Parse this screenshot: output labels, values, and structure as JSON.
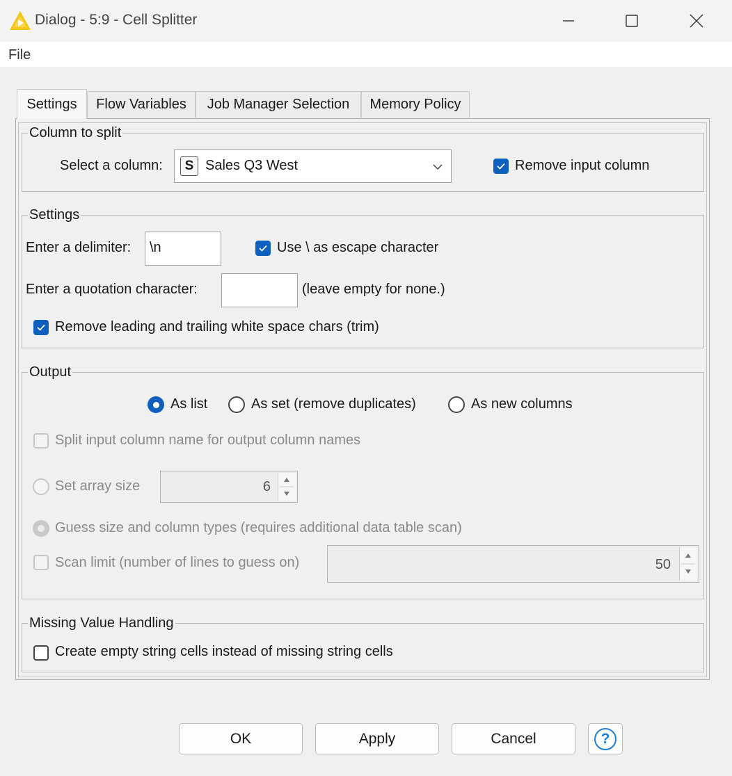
{
  "window": {
    "title": "Dialog - 5:9 - Cell Splitter"
  },
  "menu": {
    "file": "File"
  },
  "tabs": [
    "Settings",
    "Flow Variables",
    "Job Manager Selection",
    "Memory Policy"
  ],
  "column_group": {
    "legend": "Column to split",
    "select_label": "Select a column:",
    "type_badge": "S",
    "selected_column": "Sales Q3 West",
    "remove_input_label": "Remove input column",
    "remove_input_checked": true
  },
  "settings_group": {
    "legend": "Settings",
    "delimiter_label": "Enter a delimiter:",
    "delimiter_value": "\\n",
    "escape_label": "Use \\ as escape character",
    "escape_checked": true,
    "quote_label": "Enter a quotation character:",
    "quote_value": "",
    "quote_hint": "(leave empty for none.)",
    "trim_label": "Remove leading and trailing white space chars (trim)",
    "trim_checked": true
  },
  "output_group": {
    "legend": "Output",
    "options": [
      "As list",
      "As set (remove duplicates)",
      "As new columns"
    ],
    "selected": "As list",
    "split_names_label": "Split input column name for output column names",
    "array_size_label": "Set array size",
    "array_size_value": "6",
    "guess_label": "Guess size and column types (requires additional data table scan)",
    "scan_limit_label": "Scan limit (number of lines to guess on)",
    "scan_limit_value": "50"
  },
  "missing_group": {
    "legend": "Missing Value Handling",
    "empty_cells_label": "Create empty string cells instead of missing string cells",
    "empty_cells_checked": false
  },
  "buttons": {
    "ok": "OK",
    "apply": "Apply",
    "cancel": "Cancel",
    "help": "?"
  },
  "colors": {
    "accent": "#0f5fbf",
    "app_icon": "#f5c518"
  }
}
